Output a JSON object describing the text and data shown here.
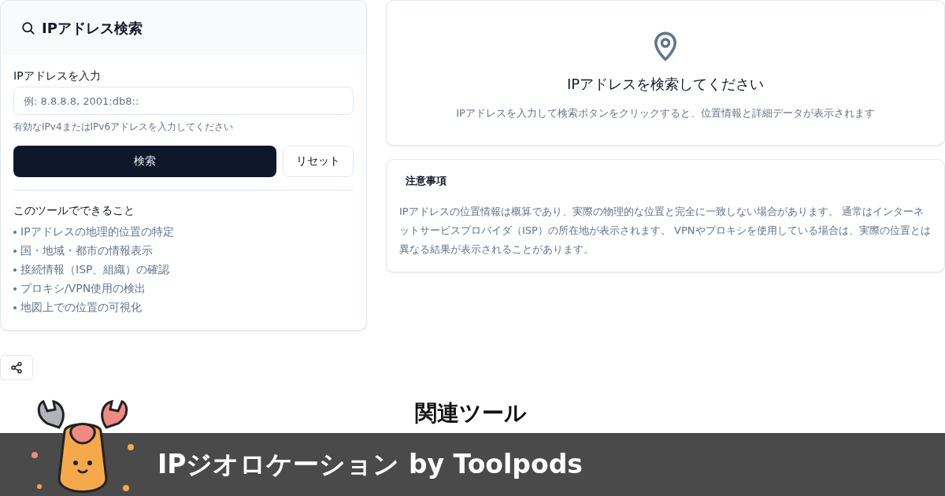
{
  "search_card": {
    "title": "IPアドレス検索",
    "input_label": "IPアドレスを入力",
    "input": {
      "placeholder": "例: 8.8.8.8, 2001:db8::"
    },
    "hint": "有効なIPv4またはIPv6アドレスを入力してください",
    "buttons": [
      {
        "label": "検索",
        "kind": "primary"
      },
      {
        "label": "リセット",
        "kind": "secondary"
      }
    ],
    "features_title": "このツールでできること",
    "features": [
      "IPアドレスの地理的位置の特定",
      "国・地域・都市の情報表示",
      "接続情報（ISP、組織）の確認",
      "プロキシ/VPN使用の検出",
      "地図上での位置の可視化"
    ]
  },
  "empty_state": {
    "title": "IPアドレスを検索してください",
    "description": "IPアドレスを入力して検索ボタンをクリックすると、位置情報と詳細データが表示されます"
  },
  "notice": {
    "title": "注意事項",
    "text": "IPアドレスの位置情報は概算であり、実際の物理的な位置と完全に一致しない場合があります。 通常はインターネットサービスプロバイダ（ISP）の所在地が表示されます。 VPNやプロキシを使用している場合は、実際の位置とは異なる結果が表示されることがあります。"
  },
  "related_heading": "関連ツール",
  "banner": {
    "title": "IPジオロケーション by Toolpods"
  }
}
